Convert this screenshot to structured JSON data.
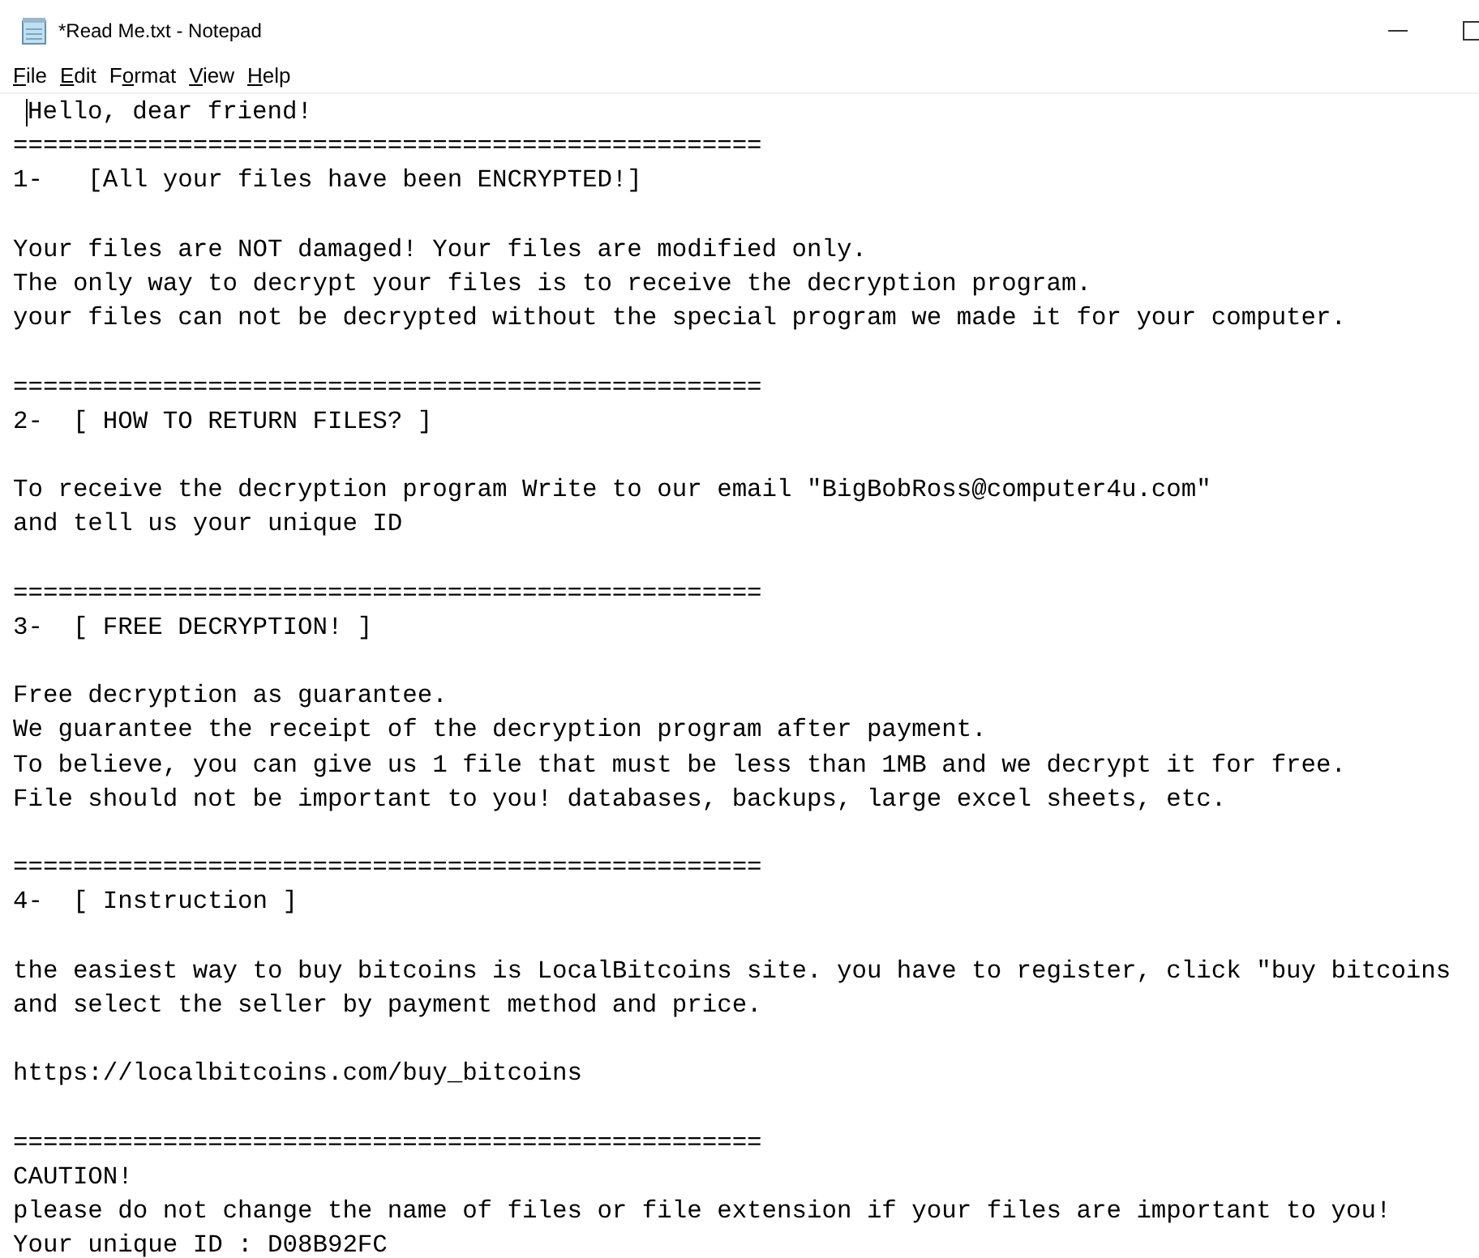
{
  "window": {
    "title": "*Read Me.txt - Notepad"
  },
  "menu": [
    {
      "access_key": "F",
      "rest": "ile"
    },
    {
      "access_key": "E",
      "rest": "dit"
    },
    {
      "lead": "F",
      "access_key": "o",
      "rest": "rmat"
    },
    {
      "access_key": "V",
      "rest": "iew"
    },
    {
      "access_key": "H",
      "rest": "elp"
    }
  ],
  "document": {
    "caret": true,
    "lines": [
      {
        "kind": "text",
        "text": "Hello, dear friend!"
      },
      {
        "kind": "text",
        "text": "=================================================="
      },
      {
        "kind": "text",
        "text": "1-   [All your files have been ENCRYPTED!]"
      },
      {
        "kind": "blank"
      },
      {
        "kind": "text",
        "text": "Your files are NOT damaged! Your files are modified only."
      },
      {
        "kind": "text",
        "text": "The only way to decrypt your files is to receive the decryption program."
      },
      {
        "kind": "text",
        "text": "your files can not be decrypted without the special program we made it for your computer."
      },
      {
        "kind": "blank"
      },
      {
        "kind": "text",
        "text": "=================================================="
      },
      {
        "kind": "text",
        "text": "2-  [ HOW TO RETURN FILES? ]"
      },
      {
        "kind": "blank"
      },
      {
        "kind": "text",
        "text": "To receive the decryption program Write to our email \"BigBobRoss@computer4u.com\""
      },
      {
        "kind": "text",
        "text": "and tell us your unique ID"
      },
      {
        "kind": "blank"
      },
      {
        "kind": "text",
        "text": "=================================================="
      },
      {
        "kind": "text",
        "text": "3-  [ FREE DECRYPTION! ]"
      },
      {
        "kind": "blank"
      },
      {
        "kind": "text",
        "text": "Free decryption as guarantee."
      },
      {
        "kind": "text",
        "text": "We guarantee the receipt of the decryption program after payment."
      },
      {
        "kind": "text",
        "text": "To believe, you can give us 1 file that must be less than 1MB and we decrypt it for free."
      },
      {
        "kind": "text",
        "text": "File should not be important to you! databases, backups, large excel sheets, etc."
      },
      {
        "kind": "blank"
      },
      {
        "kind": "text",
        "text": "=================================================="
      },
      {
        "kind": "text",
        "text": "4-  [ Instruction ]"
      },
      {
        "kind": "blank"
      },
      {
        "kind": "text",
        "text": "the easiest way to buy bitcoins is LocalBitcoins site. you have to register, click \"buy bitcoins"
      },
      {
        "kind": "text",
        "text": "and select the seller by payment method and price."
      },
      {
        "kind": "blank"
      },
      {
        "kind": "text",
        "text": "https://localbitcoins.com/buy_bitcoins"
      },
      {
        "kind": "blank"
      },
      {
        "kind": "text",
        "text": "=================================================="
      },
      {
        "kind": "text",
        "text": "CAUTION!"
      },
      {
        "kind": "text",
        "text": "please do not change the name of files or file extension if your files are important to you!"
      },
      {
        "kind": "text",
        "text": "Your unique ID : D08B92FC"
      }
    ]
  }
}
